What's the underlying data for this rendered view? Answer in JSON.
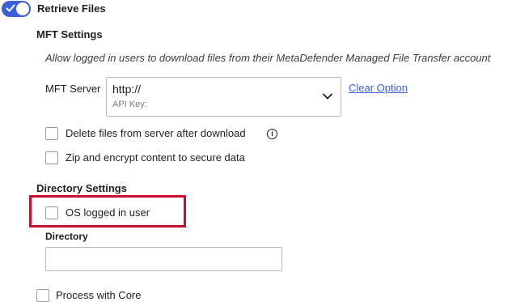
{
  "retrieve": {
    "toggle_on": true,
    "title": "Retrieve Files"
  },
  "mft": {
    "section_title": "MFT Settings",
    "description": "Allow logged in users to download files from their MetaDefender Managed File Transfer account",
    "server_label": "MFT Server",
    "server_value": "http://",
    "api_key_label": "API Key:",
    "clear_option": "Clear Option",
    "delete_files_label": "Delete files from server after download",
    "zip_encrypt_label": "Zip and encrypt content to secure data"
  },
  "directory": {
    "section_title": "Directory Settings",
    "os_logged_in_label": "OS logged in user",
    "directory_label": "Directory",
    "directory_value": ""
  },
  "process": {
    "label": "Process with Core"
  },
  "colors": {
    "accent": "#3b5fd6",
    "highlight": "#c8102e"
  }
}
